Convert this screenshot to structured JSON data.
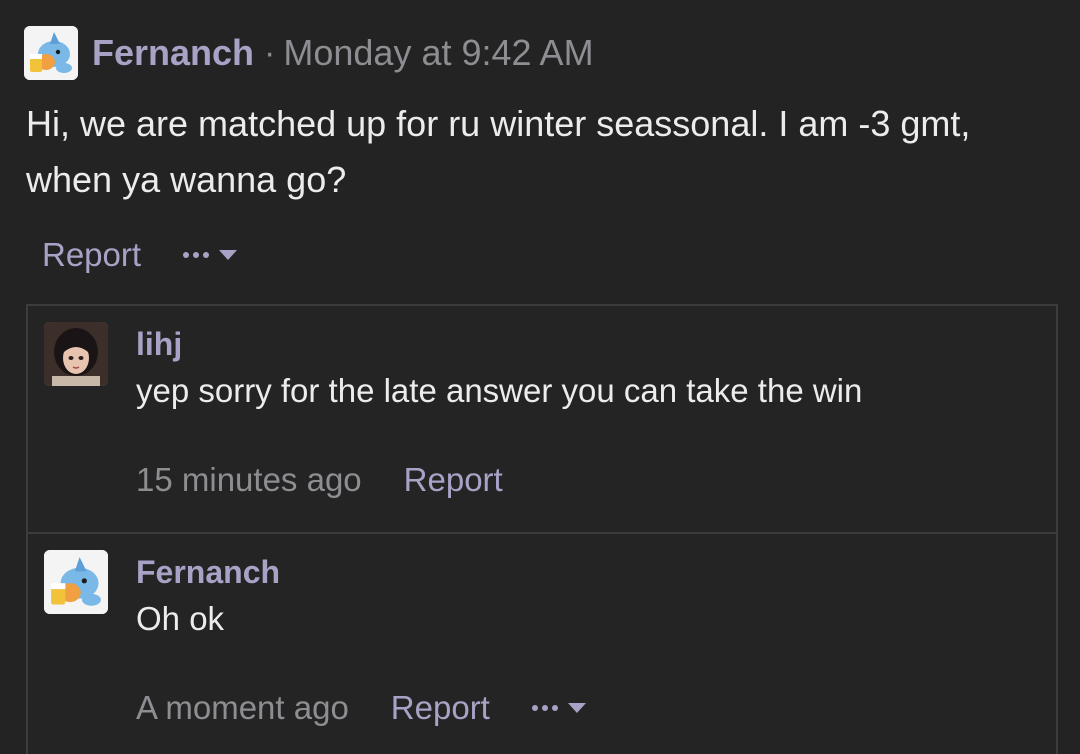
{
  "post": {
    "author": "Fernanch",
    "separator": "·",
    "timestamp": "Monday at 9:42 AM",
    "body": "Hi, we are matched up for ru winter seassonal. I am -3 gmt, when ya wanna go?",
    "actions": {
      "report_label": "Report",
      "more_icon": "ellipsis-icon",
      "caret_icon": "caret-down-icon"
    }
  },
  "replies": [
    {
      "author": "lihj",
      "text": "yep sorry for the late answer you can take the win",
      "time": "15 minutes ago",
      "report_label": "Report"
    },
    {
      "author": "Fernanch",
      "text": "Oh ok",
      "time": "A moment ago",
      "report_label": "Report"
    }
  ],
  "colors": {
    "background": "#232323",
    "username": "#a8a3c6",
    "muted": "#8d8d92",
    "text": "#ececee",
    "border": "#3c3c3f"
  }
}
